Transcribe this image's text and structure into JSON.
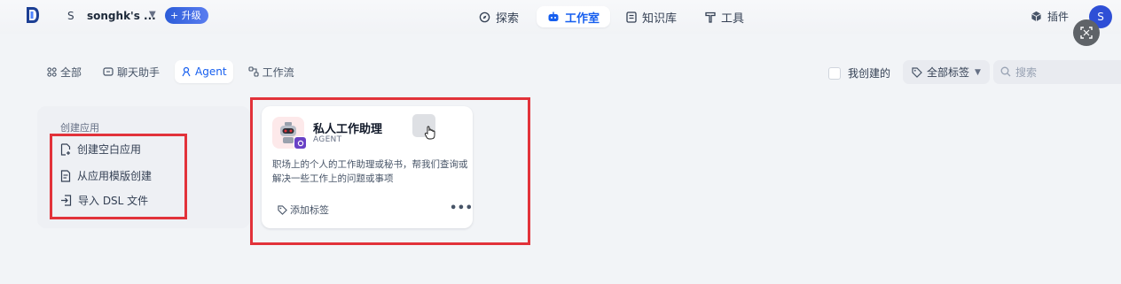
{
  "workspace": {
    "letter": "S",
    "name": "songhk's ...",
    "upgrade_label": "升级"
  },
  "nav": {
    "explore": "探索",
    "studio": "工作室",
    "knowledge": "知识库",
    "tools": "工具"
  },
  "header_right": {
    "plugins": "插件",
    "avatar_letter": "S"
  },
  "filters": {
    "tabs": [
      {
        "label": "全部",
        "icon": "grid-icon"
      },
      {
        "label": "聊天助手",
        "icon": "chat-icon"
      },
      {
        "label": "Agent",
        "icon": "agent-icon"
      },
      {
        "label": "工作流",
        "icon": "workflow-icon"
      }
    ],
    "active_tab": "Agent",
    "mine_label": "我创建的",
    "tag_filter_label": "全部标签",
    "search_placeholder": "搜索"
  },
  "create": {
    "title": "创建应用",
    "items": [
      "创建空白应用",
      "从应用模版创建",
      "导入 DSL 文件"
    ]
  },
  "app": {
    "name": "私人工作助理",
    "type": "AGENT",
    "description": "职场上的个人的工作助理或秘书，帮我们查询或解决一些工作上的问题或事项",
    "add_tag": "添加标签",
    "more": "•••"
  },
  "colors": {
    "accent": "#155eef",
    "highlight": "#e2323a",
    "upgrade": "#2b5cd8"
  }
}
